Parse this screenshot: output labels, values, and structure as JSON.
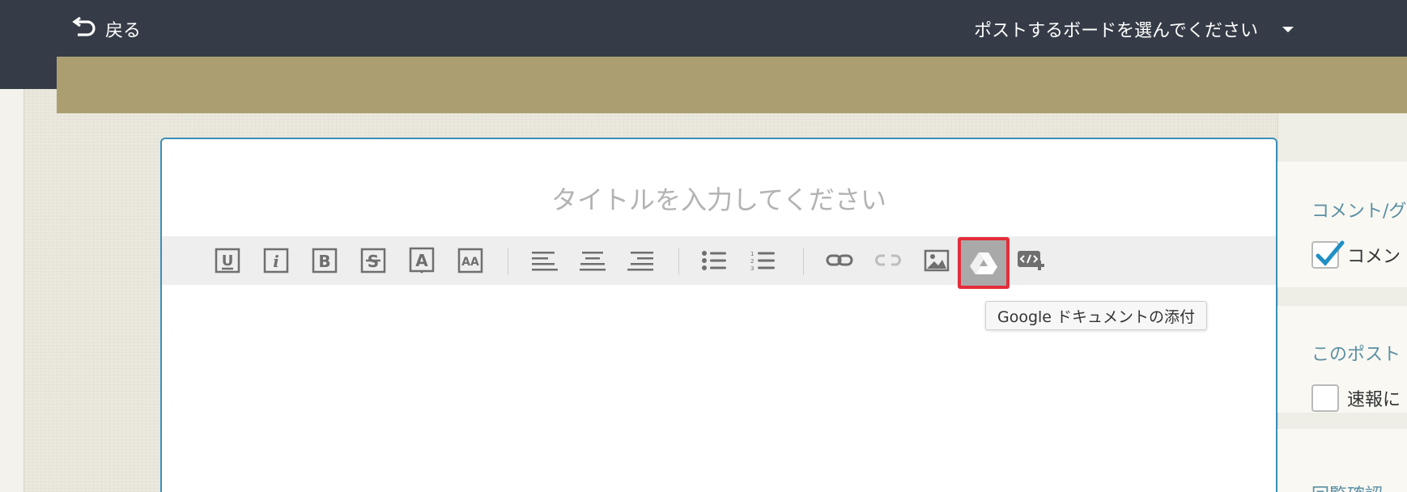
{
  "header": {
    "back_label": "戻る",
    "board_select_label": "ポストするボードを選んでください"
  },
  "editor": {
    "title_placeholder": "タイトルを入力してください",
    "toolbar": {
      "underline_glyph": "U",
      "italic_glyph": "i",
      "bold_glyph": "B",
      "strike_glyph": "S",
      "font_color_glyph": "A",
      "font_size_glyph": "AA"
    },
    "tooltip": "Google ドキュメントの添付"
  },
  "right_panel": {
    "comment_heading": "コメント/グ",
    "comment_checkbox_label": "コメン",
    "comment_checked": true,
    "post_heading": "このポスト",
    "breaking_checkbox_label": "速報に",
    "breaking_checked": false,
    "third_heading": "回覧確認"
  },
  "colors": {
    "topbar": "#353c47",
    "gold_band": "#ab9f72",
    "editor_border": "#3a8fb8",
    "highlight": "#e42d3a",
    "heading_text": "#5a8fa3",
    "check_blue": "#1f8fc6"
  },
  "icons": {
    "back": "undo-arrow-icon",
    "caret": "caret-down-icon",
    "drive": "google-drive-icon",
    "link": "link-icon",
    "unlink": "unlink-icon",
    "image": "image-icon",
    "embed": "embed-code-icon"
  }
}
